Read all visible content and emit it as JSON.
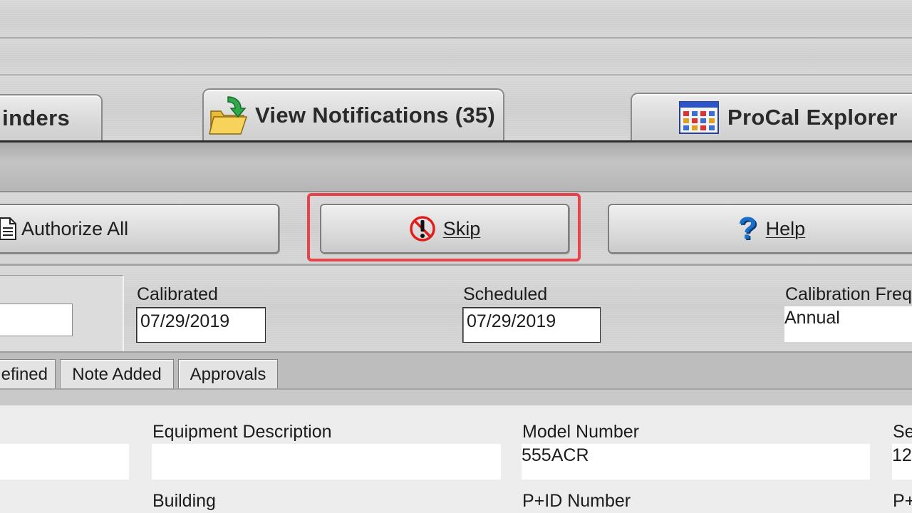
{
  "tabs": {
    "reminders": "inders",
    "notifications": "View Notifications (35)",
    "explorer": "ProCal Explorer"
  },
  "toolbar": {
    "authorize_all": "Authorize All",
    "skip": "Skip",
    "help": "Help"
  },
  "dates": {
    "calibrated_label": "Calibrated",
    "calibrated_value": "07/29/2019",
    "scheduled_label": "Scheduled",
    "scheduled_value": "07/29/2019",
    "frequency_label": "Calibration Freq",
    "frequency_value": "Annual"
  },
  "subtabs": {
    "defined": "efined",
    "note_added": "Note Added",
    "approvals": "Approvals"
  },
  "details": {
    "equipment_description_label": "Equipment Description",
    "equipment_description_value": "",
    "model_number_label": "Model Number",
    "model_number_value": "555ACR",
    "serial_label": "Se",
    "serial_value": "12",
    "building_label": "Building",
    "pid_number_label": "P+ID Number",
    "p_label": "P+"
  },
  "colors": {
    "highlight": "#e8434a",
    "help_icon": "#1a6fc9",
    "skip_icon": "#e21b1b"
  },
  "icons": {
    "notifications_tab": "folder-arrow-icon",
    "explorer_tab": "grid-window-icon",
    "authorize": "document-icon",
    "skip": "no-entry-exclamation-icon",
    "help": "question-mark-icon"
  }
}
